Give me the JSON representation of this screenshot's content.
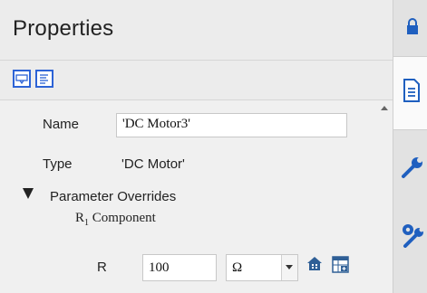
{
  "panel": {
    "title": "Properties"
  },
  "toolbar": {
    "buttons": [
      {
        "icon": "comment-icon"
      },
      {
        "icon": "text-lines-icon"
      }
    ]
  },
  "properties": {
    "name_label": "Name",
    "name_value": "'DC Motor3'",
    "type_label": "Type",
    "type_value": "'DC Motor'",
    "section_label": "Parameter Overrides",
    "component_prefix": "R",
    "component_subscript": "1",
    "component_suffix": " Component",
    "r_label": "R",
    "r_value": "100",
    "r_unit": "Ω"
  },
  "right_tabs": [
    {
      "icon": "lock-icon"
    },
    {
      "icon": "document-icon",
      "active": true
    },
    {
      "icon": "wrench-icon"
    },
    {
      "icon": "wrench-gear-icon"
    }
  ],
  "colors": {
    "accent": "#2d63d6",
    "panel_bg": "#f0f0f0",
    "icon_blue": "#1f5fbf"
  }
}
